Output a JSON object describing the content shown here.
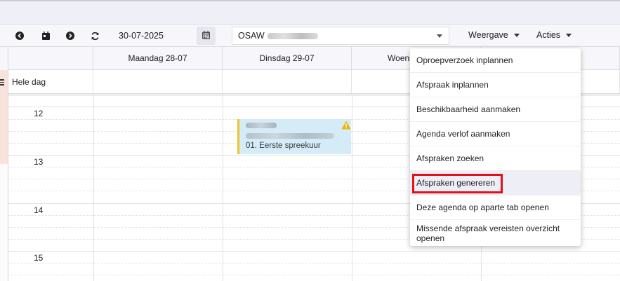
{
  "toolbar": {
    "date": "30-07-2025",
    "agenda_prefix": "OSAW",
    "weergave_label": "Weergave",
    "acties_label": "Acties"
  },
  "calendar": {
    "days": [
      {
        "label": "Maandag 28-07"
      },
      {
        "label": "Dinsdag 29-07"
      },
      {
        "label": "Woens"
      }
    ],
    "allday_label": "Hele dag",
    "hours": [
      "12",
      "13",
      "14",
      "15"
    ],
    "event": {
      "title": "01. Eerste spreekuur",
      "accent_color": "#f0c22c",
      "background_color": "#d4ebf8"
    }
  },
  "acties_menu": {
    "items": [
      {
        "label": "Oproepverzoek inplannen"
      },
      {
        "label": "Afspraak inplannen"
      },
      {
        "label": "Beschikbaarheid aanmaken"
      },
      {
        "label": "Agenda verlof aanmaken"
      },
      {
        "label": "Afspraken zoeken"
      },
      {
        "label": "Afspraken genereren"
      },
      {
        "label": "Deze agenda op aparte tab openen"
      },
      {
        "label": "Missende afspraak vereisten overzicht openen"
      }
    ],
    "highlight_color": "#e0111b"
  }
}
